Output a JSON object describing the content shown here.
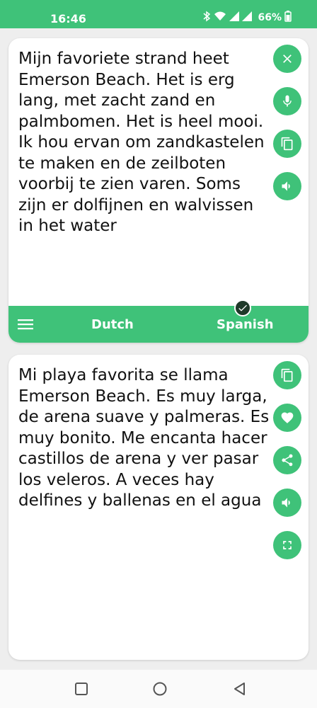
{
  "status_bar": {
    "time": "16:46",
    "battery": "66%"
  },
  "source_card": {
    "text": "Mijn favoriete strand heet Emerson Beach. Het is erg lang, met zacht zand en palmbomen. Het is heel mooi. Ik hou ervan om zandkastelen te maken en de zeilboten voorbij te zien varen. Soms zijn er dolfijnen en walvissen in het water",
    "actions": [
      "close-icon",
      "mic-icon",
      "copy-icon",
      "speaker-icon"
    ]
  },
  "language_bar": {
    "source_language": "Dutch",
    "target_language": "Spanish"
  },
  "target_card": {
    "text": "Mi playa favorita se llama Emerson Beach. Es muy larga, de arena suave y palmeras. Es muy bonito. Me encanta hacer castillos de arena y ver pasar los veleros. A veces hay delfines y ballenas en el agua",
    "actions": [
      "copy-icon",
      "heart-icon",
      "share-icon",
      "speaker-icon",
      "fullscreen-icon"
    ]
  },
  "colors": {
    "accent": "#3fc279",
    "check_badge": "#1f3a2a",
    "text": "#111111",
    "background": "#eeeeee"
  }
}
